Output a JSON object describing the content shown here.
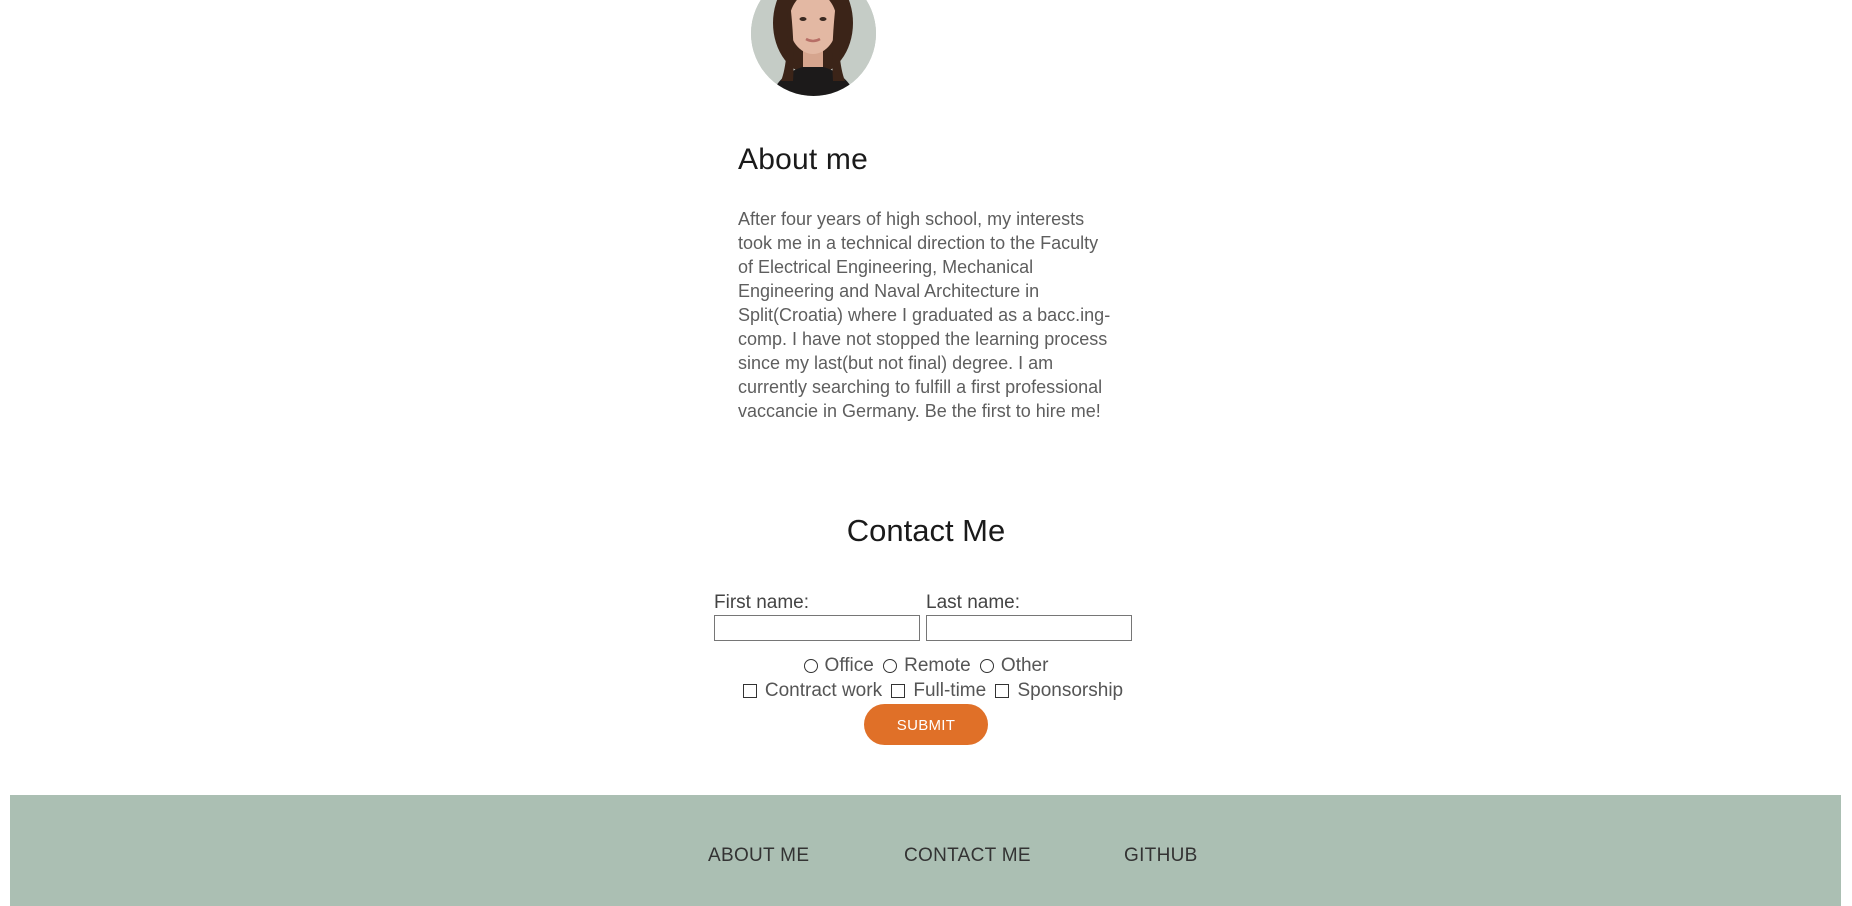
{
  "about": {
    "heading": "About me",
    "text": "After four years of high school, my interests took me in a technical direction to the Faculty of Electrical Engineering, Mechanical Engineering and Naval Architecture in Split(Croatia) where I graduated as a bacc.ing-comp. I have not stopped the learning process since my last(but not final) degree. I am currently searching to fulfill a first professional vaccancie in Germany. Be the first to hire me!"
  },
  "contact": {
    "heading": "Contact Me",
    "first_name_label": "First name:",
    "first_name_value": "",
    "last_name_label": "Last name:",
    "last_name_value": "",
    "radios": [
      {
        "label": "Office",
        "selected": false
      },
      {
        "label": "Remote",
        "selected": false
      },
      {
        "label": "Other",
        "selected": false
      }
    ],
    "checkboxes": [
      {
        "label": "Contract work",
        "checked": false
      },
      {
        "label": "Full-time",
        "checked": false
      },
      {
        "label": "Sponsorship",
        "checked": false
      }
    ],
    "submit_label": "SUBMIT"
  },
  "footer": {
    "links": [
      "ABOUT ME",
      "CONTACT ME",
      "GITHUB"
    ]
  },
  "colors": {
    "accent": "#e07028",
    "footer_bg": "#abbfb3"
  }
}
